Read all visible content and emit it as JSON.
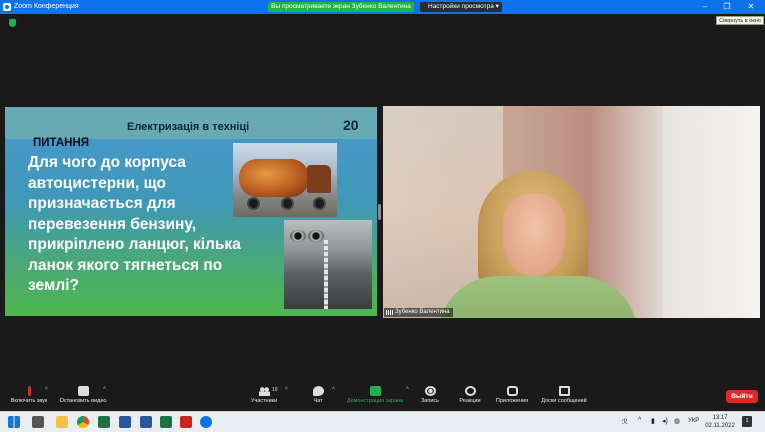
{
  "titlebar": {
    "app_title": "Zoom Конференция",
    "share_notice": "Вы просматриваете экран Зубенко Валентина",
    "view_options": "Настройки просмотра",
    "tooltip": "Свернуть в окно"
  },
  "slide": {
    "heading": "Електризація в техніці",
    "number": "20",
    "section": "ПИТАННЯ",
    "question": "Для чого до корпуса автоцистерни, що призначається для перевезення бензину, прикріплено ланцюг, кілька ланок якого тягнеться по землі?"
  },
  "video": {
    "participant_name": "Зубенко Валентина"
  },
  "toolbar": {
    "mute_label": "Включить звук",
    "video_label": "Остановить видео",
    "participants_label": "Участники",
    "participants_count": "19",
    "chat_label": "Чат",
    "share_label": "Демонстрация экрана",
    "record_label": "Запись",
    "reactions_label": "Реакции",
    "apps_label": "Приложения",
    "whiteboard_label": "Доски сообщений",
    "leave_label": "Выйти"
  },
  "taskbar": {
    "language": "УКР",
    "time": "13:17",
    "date": "02.11.2022",
    "notifications": "1"
  },
  "colors": {
    "zoom_blue": "#0e72ed",
    "share_green": "#23b14d",
    "leave_red": "#e02828"
  },
  "icons": [
    "zoom-app-icon",
    "shield-icon",
    "mic-muted-icon",
    "camera-icon",
    "participants-icon",
    "chat-icon",
    "share-screen-icon",
    "record-icon",
    "reactions-icon",
    "apps-icon",
    "whiteboard-icon",
    "windows-start-icon"
  ]
}
